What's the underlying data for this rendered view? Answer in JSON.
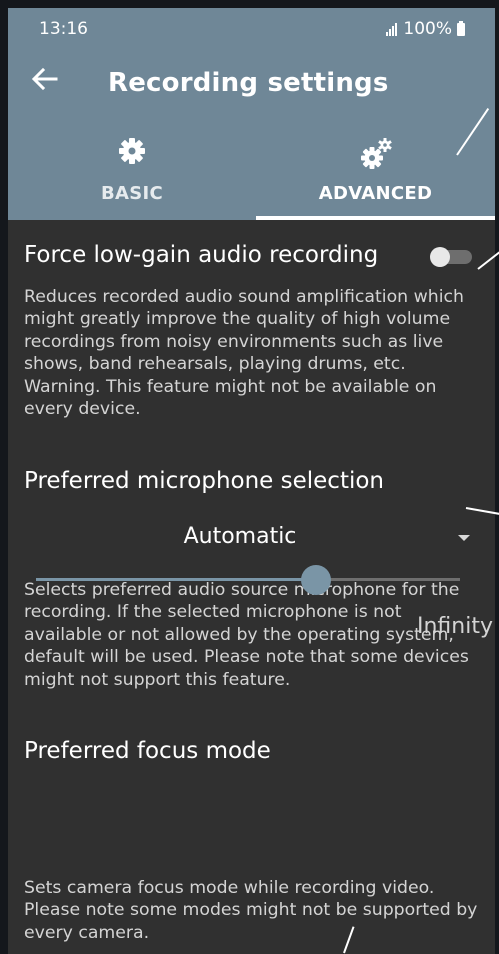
{
  "status_bar": {
    "time": "13:16",
    "battery": "100%"
  },
  "toolbar": {
    "title": "Recording settings",
    "back_icon": "arrow-left-icon"
  },
  "tabs": [
    {
      "label": "BASIC",
      "icon": "gear-icon",
      "selected": false
    },
    {
      "label": "ADVANCED",
      "icon": "gears-icon",
      "selected": true
    }
  ],
  "settings": {
    "low_gain": {
      "title": "Force low-gain audio recording",
      "description": "Reduces recorded audio sound amplification which might greatly improve the quality of high volume recordings from noisy environments such as live shows, band rehearsals, playing drums, etc. Warning. This feature might not be available on every device.",
      "enabled": false
    },
    "microphone": {
      "title": "Preferred microphone selection",
      "selected": "Automatic",
      "description": "Selects preferred audio source microphone for the recording. If the selected microphone is not available or not allowed by the operating system, default will be used. Please note that some devices might not support this feature."
    },
    "focus": {
      "title": "Preferred focus mode",
      "value_label": "Infinity",
      "level": 0.66,
      "description": "Sets camera focus mode while recording video. Please note some modes might not be supported by every camera."
    }
  },
  "colors": {
    "app_bar": "#6f8797",
    "background": "#303030",
    "accent": "#7a95a6"
  }
}
